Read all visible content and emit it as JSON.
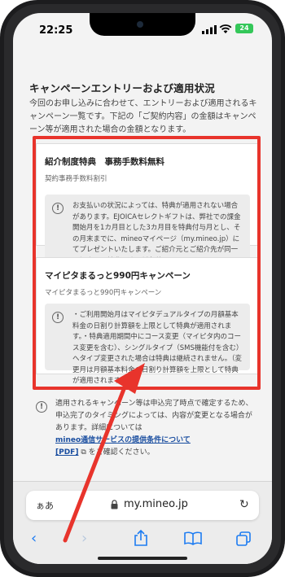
{
  "status": {
    "time": "22:25",
    "battery": "24"
  },
  "page": {
    "title": "キャンペーンエントリーおよび適用状況",
    "intro": "今回のお申し込みに合わせて、エントリーおよび適用されるキャンペーン一覧です。下記の「ご契約内容」の金額はキャンペーン等が適用された場合の金額となります。"
  },
  "campaigns": [
    {
      "title": "紹介制度特典　事務手数料無料",
      "subtitle": "契約事務手数料割引",
      "notice": "お支払いの状況によっては、特典が適用されない場合があります。EJOICAセレクトギフトは、弊社での課金開始月を1カ月目とした3カ月目を特典付与月とし、その月末までに、mineoマイページ（my.mineo.jp）にてプレゼントいたします。ご紹介元とご紹介先が同一の場合は、特典の適用対象外となります。"
    },
    {
      "title": "マイピタまるっと990円キャンペーン",
      "subtitle": "マイピタまるっと990円キャンペーン",
      "notice": "・ご利用開始月はマイピタデュアルタイプの月額基本料金の日割り計算額を上限として特典が適用されます。・特典適用期間中にコース変更（マイピタ内のコース変更を含む）、シングルタイプ（SMS機能付を含む）へタイプ変更された場合は特典は継続されません。（変更月は月額基本料金の日割り計算額を上限として特典が適用されます。）"
    }
  ],
  "footer": {
    "text_before": "適用されるキャンペーン等は申込完了時点で確定するため、申込完了のタイミングによっては、内容が変更となる場合があります。詳細については",
    "link": "mineo通信サービスの提供条件について",
    "pdf": "[PDF]",
    "text_after": "をご確認ください。"
  },
  "browser": {
    "aa_label": "ぁあ",
    "url": "my.mineo.jp"
  },
  "annotation": {
    "color": "#e8342c"
  }
}
